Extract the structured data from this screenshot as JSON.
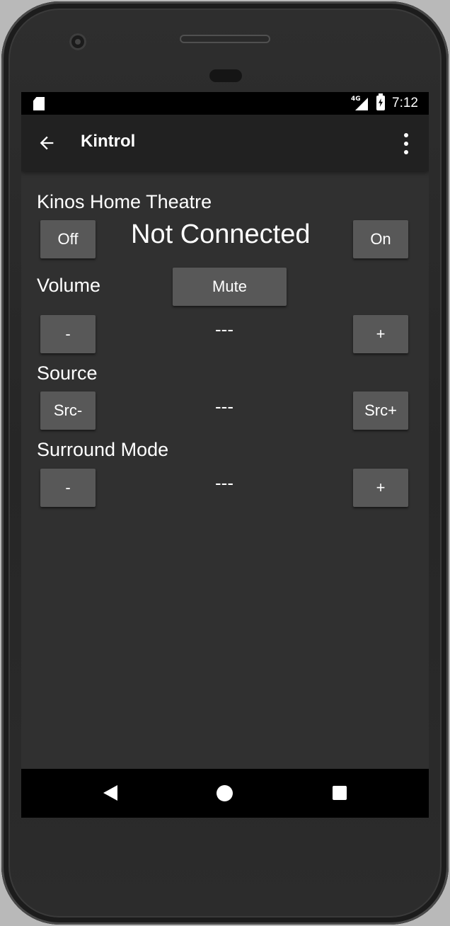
{
  "status_bar": {
    "network": "4G",
    "time": "7:12"
  },
  "app_bar": {
    "title": "Kintrol"
  },
  "device": {
    "name": "Kinos Home Theatre",
    "connection_status": "Not Connected",
    "off_label": "Off",
    "on_label": "On"
  },
  "volume": {
    "label": "Volume",
    "mute_label": "Mute",
    "down_label": "-",
    "up_label": "+",
    "value": "---"
  },
  "source": {
    "label": "Source",
    "prev_label": "Src-",
    "next_label": "Src+",
    "value": "---"
  },
  "surround": {
    "label": "Surround Mode",
    "prev_label": "-",
    "next_label": "+",
    "value": "---"
  },
  "colors": {
    "screen_bg": "#303030",
    "app_bar_bg": "#212121",
    "button_bg": "#585858",
    "text": "#ffffff"
  },
  "icons": {
    "sd_card": "sd-card-icon",
    "signal": "signal-icon",
    "battery": "battery-charging-icon",
    "back": "arrow-back-icon",
    "more": "more-vert-icon",
    "nav_back": "nav-back-icon",
    "nav_home": "nav-home-icon",
    "nav_recents": "nav-recents-icon"
  }
}
